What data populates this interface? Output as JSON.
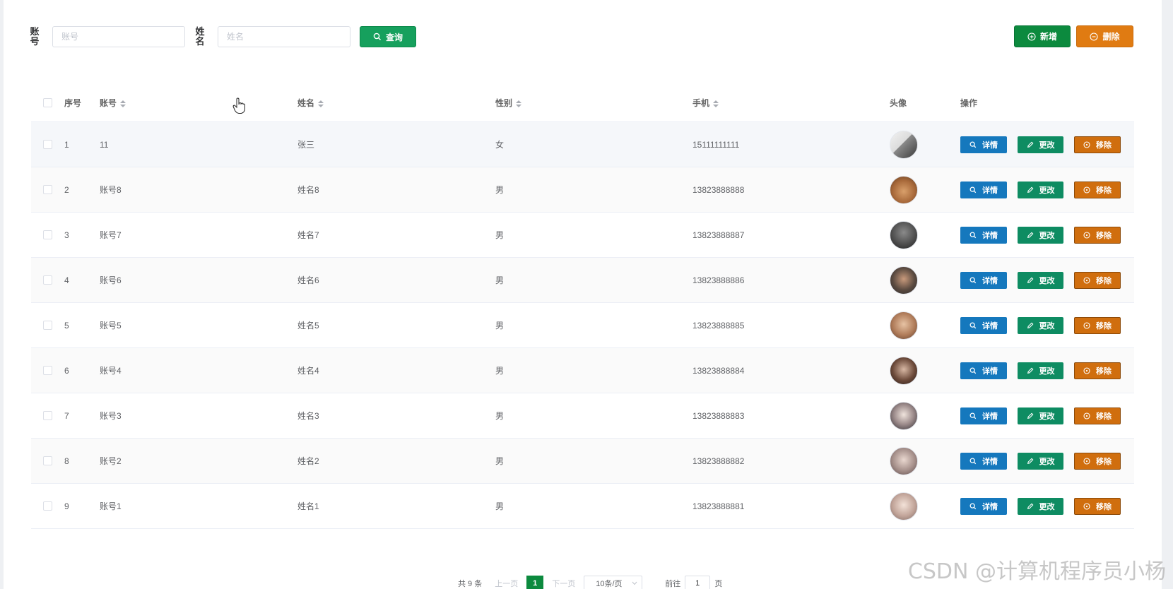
{
  "search": {
    "account_label": "账号",
    "account_placeholder": "账号",
    "name_label": "姓名",
    "name_placeholder": "姓名",
    "query_label": "查询"
  },
  "toolbar": {
    "add_label": "新增",
    "delete_label": "删除"
  },
  "table": {
    "headers": {
      "index": "序号",
      "account": "账号",
      "name": "姓名",
      "gender": "性别",
      "phone": "手机",
      "avatar": "头像",
      "ops": "操作"
    },
    "ops": {
      "detail": "详情",
      "edit": "更改",
      "remove": "移除"
    },
    "rows": [
      {
        "index": "1",
        "account": "11",
        "name": "张三",
        "gender": "女",
        "phone": "15111111111"
      },
      {
        "index": "2",
        "account": "账号8",
        "name": "姓名8",
        "gender": "男",
        "phone": "13823888888"
      },
      {
        "index": "3",
        "account": "账号7",
        "name": "姓名7",
        "gender": "男",
        "phone": "13823888887"
      },
      {
        "index": "4",
        "account": "账号6",
        "name": "姓名6",
        "gender": "男",
        "phone": "13823888886"
      },
      {
        "index": "5",
        "account": "账号5",
        "name": "姓名5",
        "gender": "男",
        "phone": "13823888885"
      },
      {
        "index": "6",
        "account": "账号4",
        "name": "姓名4",
        "gender": "男",
        "phone": "13823888884"
      },
      {
        "index": "7",
        "account": "账号3",
        "name": "姓名3",
        "gender": "男",
        "phone": "13823888883"
      },
      {
        "index": "8",
        "account": "账号2",
        "name": "姓名2",
        "gender": "男",
        "phone": "13823888882"
      },
      {
        "index": "9",
        "account": "账号1",
        "name": "姓名1",
        "gender": "男",
        "phone": "13823888881"
      }
    ]
  },
  "pagination": {
    "total": "共 9 条",
    "prev": "上一页",
    "current": "1",
    "next": "下一页",
    "page_size": "10条/页",
    "goto_label": "前往",
    "goto_value": "1",
    "page_unit": "页"
  },
  "watermark": "CSDN @计算机程序员小杨",
  "colors": {
    "query": "#16a05d",
    "add": "#0c8a3e",
    "delete": "#e07b12",
    "detail": "#1578bd",
    "edit": "#0e8c62",
    "remove": "#d06e0e"
  },
  "icons": {
    "query": "search-icon",
    "add": "plus-circle-icon",
    "delete": "minus-circle-icon",
    "detail": "search-icon",
    "edit": "pencil-icon",
    "remove": "remove-circle-icon"
  }
}
